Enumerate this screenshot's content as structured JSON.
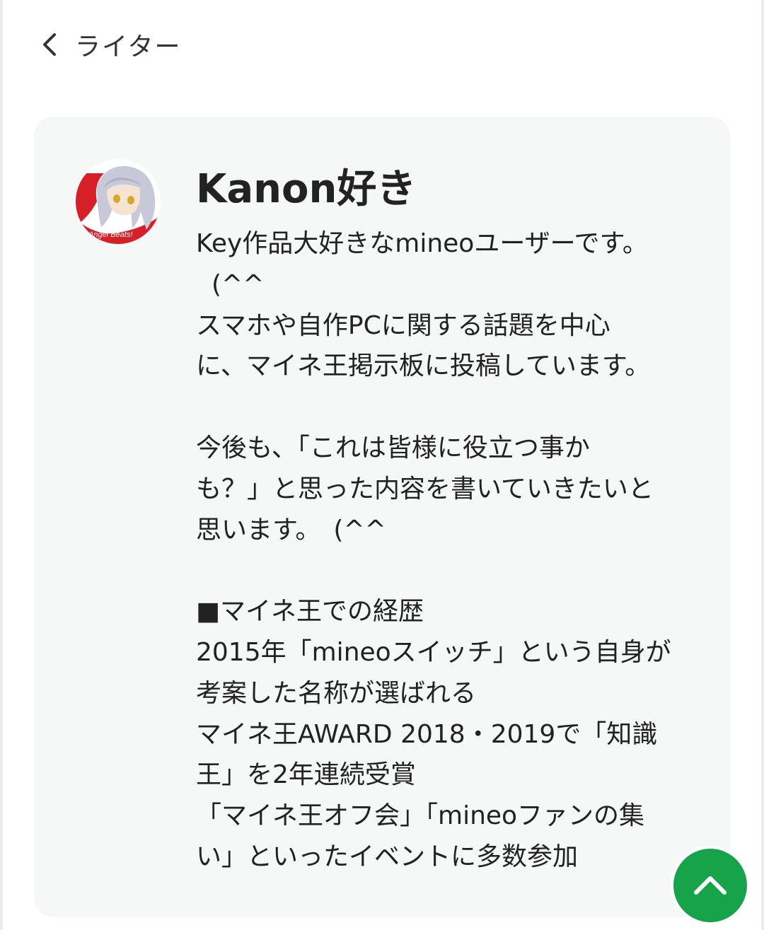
{
  "header": {
    "back_icon": "chevron-left-icon",
    "title": "ライター"
  },
  "profile": {
    "avatar_icon": "anime-character-avatar",
    "avatar_caption": "Angel Beats!",
    "name": "Kanon好き",
    "bio_lines": [
      "Key作品大好きなmineoユーザーです。",
      "(^^",
      "スマホや自作PCに関する話題を中心",
      "に、マイネ王掲示板に投稿しています。",
      "",
      "今後も、「これは皆様に役立つ事か",
      "も？」と思った内容を書いていきたいと",
      "思います。　(^^",
      "",
      "■マイネ王での経歴",
      "2015年「mineoスイッチ」という自身が",
      "考案した名称が選ばれる",
      "マイネ王AWARD 2018・2019で「知識",
      "王」を2年連続受賞",
      "「マイネ王オフ会」「mineoファンの集",
      "い」といったイベントに多数参加"
    ]
  },
  "scroll_top": {
    "icon": "chevron-up-icon",
    "color": "#17a34a"
  },
  "colors": {
    "card_background": "#f6f7f7",
    "text": "#222222",
    "accent_green": "#17a34a"
  }
}
